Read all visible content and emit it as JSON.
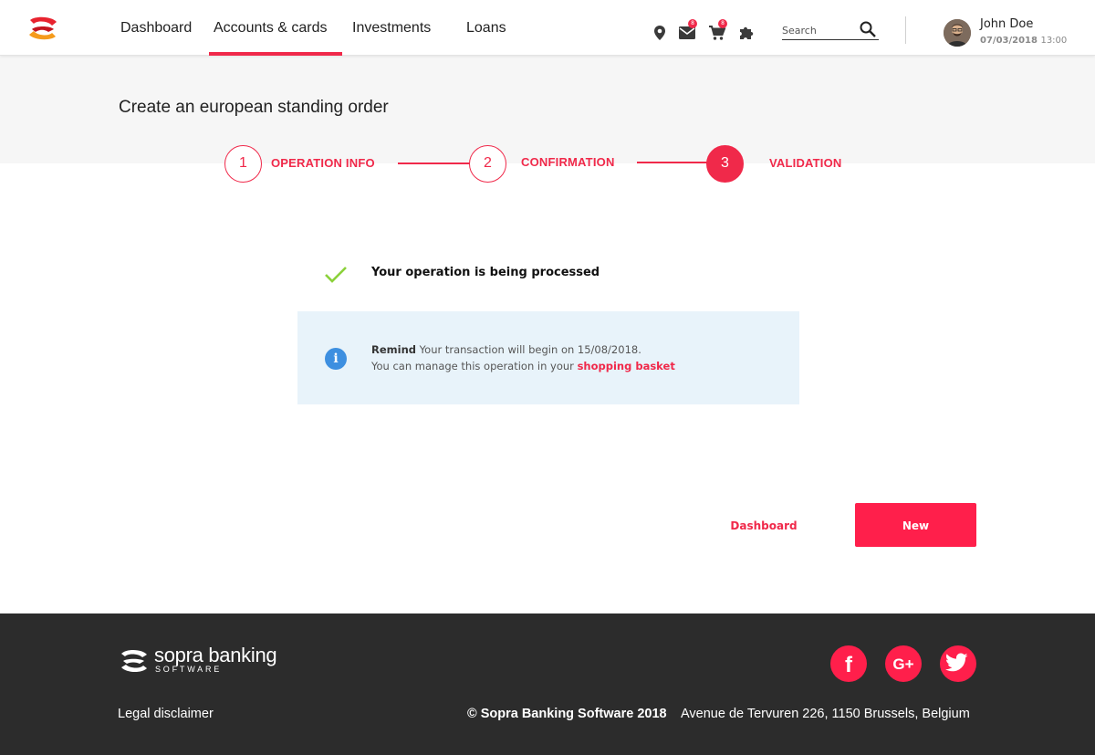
{
  "header": {
    "nav": [
      {
        "label": "Dashboard"
      },
      {
        "label": "Accounts & cards",
        "active": true
      },
      {
        "label": "Investments"
      },
      {
        "label": "Loans"
      }
    ],
    "icons": {
      "location": "location-pin-icon",
      "mail": "mail-icon",
      "cart": "cart-icon",
      "extensions": "puzzle-icon"
    },
    "mail_badge": "8",
    "cart_badge": "8",
    "search_placeholder": "Search",
    "user": {
      "name": "John Doe",
      "date": "07/03/2018",
      "time": "13:00"
    }
  },
  "page": {
    "title": "Create an european standing order"
  },
  "stepper": {
    "steps": [
      {
        "number": "1",
        "label": "OPERATION INFO"
      },
      {
        "number": "2",
        "label": "CONFIRMATION"
      },
      {
        "number": "3",
        "label": "VALIDATION",
        "active": true
      }
    ]
  },
  "status": {
    "message": "Your operation is being processed"
  },
  "info": {
    "icon_glyph": "i",
    "title": "Remind",
    "line1": "Your transaction will begin on 15/08/2018.",
    "line2_prefix": "You can manage this operation in your",
    "link": "shopping basket"
  },
  "actions": {
    "dashboard": "Dashboard",
    "new": "New"
  },
  "footer": {
    "brand": "sopra banking",
    "brand_sub": "SOFTWARE",
    "legal": "Legal disclaimer",
    "copyright": "© Sopra Banking Software 2018",
    "address": "Avenue de Tervuren 226, 1150 Brussels, Belgium",
    "social": [
      {
        "name": "facebook",
        "glyph": "f"
      },
      {
        "name": "google-plus",
        "glyph": "G+"
      },
      {
        "name": "twitter"
      }
    ]
  },
  "colors": {
    "accent": "#f0294a",
    "button": "#ff1f4b",
    "info_bg": "#e8f3fa",
    "info_icon": "#3d8fe0",
    "check": "#8bd13a",
    "footer_bg": "#2c2c2c",
    "band_bg": "#f6f6f6"
  }
}
